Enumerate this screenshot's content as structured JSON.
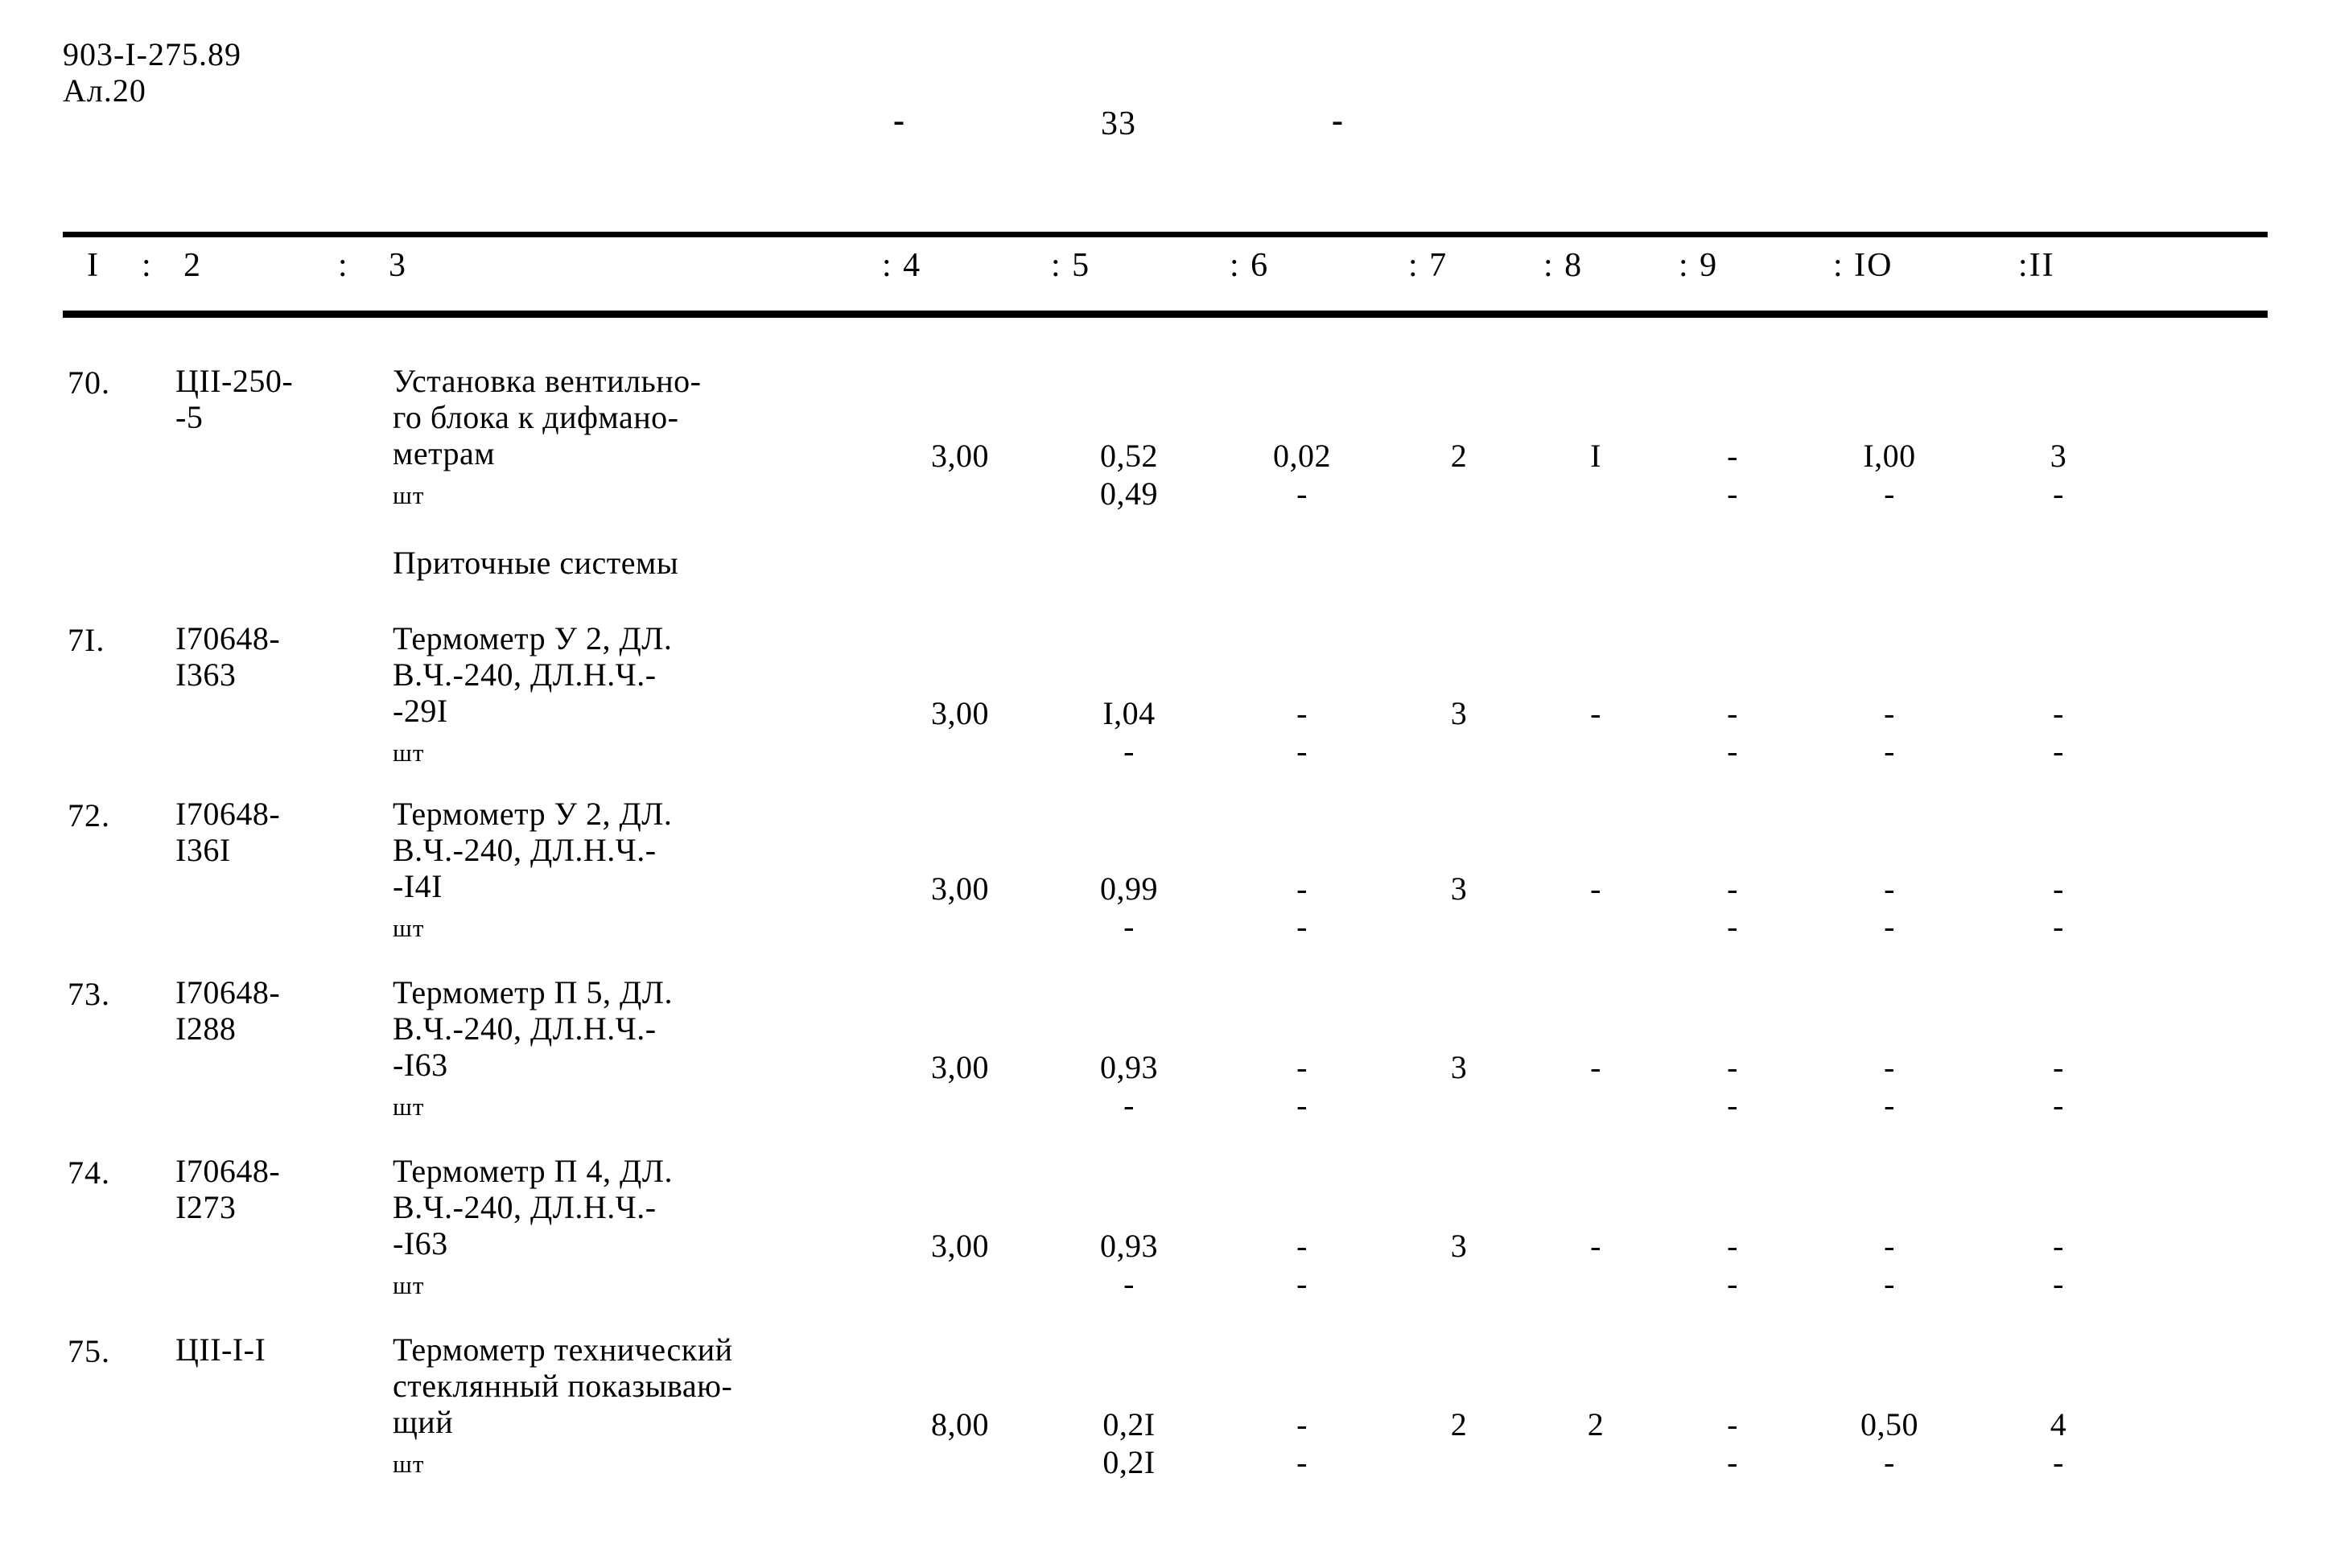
{
  "header": {
    "doc_code": "903-I-275.89",
    "sheet": "Ал.20",
    "page_dash_left": "-",
    "page_number": "33",
    "page_dash_right": "-"
  },
  "table": {
    "column_headers": [
      "I",
      ":",
      "2",
      ":",
      "3",
      ": 4",
      ": 5",
      ": 6",
      ": 7",
      ": 8",
      ": 9",
      ": IO",
      ":II"
    ],
    "headers": {
      "h1": "I",
      "s1": ":",
      "h2": "2",
      "s2": ":",
      "h3": "3",
      "h4": ": 4",
      "h5": ": 5",
      "h6": ": 6",
      "h7": ": 7",
      "h8": ": 8",
      "h9": ": 9",
      "h10": ": IO",
      "h11": ":II"
    },
    "rows": [
      {
        "num": "70.",
        "code": "ЦII-250-\n-5",
        "name": "Установка вентильно-\nго блока к дифмано-\nметрам",
        "unit": "шт",
        "c4": "3,00",
        "c5": "0,52\n0,49",
        "c6": "0,02\n-",
        "c7": "2",
        "c8": "I",
        "c9": "-\n-",
        "c10": "I,00\n-",
        "c11": "3\n-"
      },
      {
        "num": "7I.",
        "code": "I70648-\nI363",
        "name": "Термометр У 2, ДЛ.\nВ.Ч.-240, ДЛ.Н.Ч.-\n-29I",
        "unit": "шт",
        "c4": "3,00",
        "c5": "I,04\n-",
        "c6": "-\n-",
        "c7": "3",
        "c8": "-",
        "c9": "-\n-",
        "c10": "-\n-",
        "c11": "-\n-"
      },
      {
        "num": "72.",
        "code": "I70648-\nI36I",
        "name": "Термометр У 2, ДЛ.\nВ.Ч.-240, ДЛ.Н.Ч.-\n-I4I",
        "unit": "шт",
        "c4": "3,00",
        "c5": "0,99\n-",
        "c6": "-\n-",
        "c7": "3",
        "c8": "-",
        "c9": "-\n-",
        "c10": "-\n-",
        "c11": "-\n-"
      },
      {
        "num": "73.",
        "code": "I70648-\nI288",
        "name": "Термометр П 5, ДЛ.\nВ.Ч.-240, ДЛ.Н.Ч.-\n-I63",
        "unit": "шт",
        "c4": "3,00",
        "c5": "0,93\n-",
        "c6": "-\n-",
        "c7": "3",
        "c8": "-",
        "c9": "-\n-",
        "c10": "-\n-",
        "c11": "-\n-"
      },
      {
        "num": "74.",
        "code": "I70648-\nI273",
        "name": "Термометр П 4, ДЛ.\nВ.Ч.-240, ДЛ.Н.Ч.-\n-I63",
        "unit": "шт",
        "c4": "3,00",
        "c5": "0,93\n-",
        "c6": "-\n-",
        "c7": "3",
        "c8": "-",
        "c9": "-\n-",
        "c10": "-\n-",
        "c11": "-\n-"
      },
      {
        "num": "75.",
        "code": "ЦII-I-I",
        "name": "Термометр технический\nстеклянный показываю-\nщий",
        "unit": "шт",
        "c4": "8,00",
        "c5": "0,2I\n0,2I",
        "c6": "-\n-",
        "c7": "2",
        "c8": "2",
        "c9": "-\n-",
        "c10": "0,50\n-",
        "c11": "4\n-"
      }
    ],
    "section_label": "Приточные системы"
  }
}
